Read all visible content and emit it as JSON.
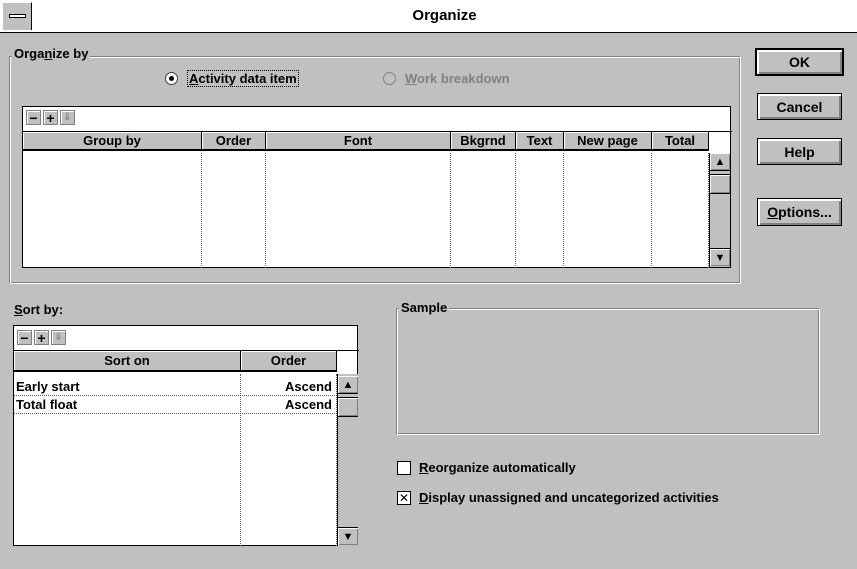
{
  "window": {
    "title": "Organize"
  },
  "organize_by": {
    "label_pre": "Orga",
    "label_key": "n",
    "label_post": "ize by",
    "options": [
      {
        "key": "A",
        "rest": "ctivity data item",
        "selected": true,
        "enabled": true
      },
      {
        "key": "W",
        "rest": "ork breakdown",
        "selected": false,
        "enabled": false
      }
    ],
    "toolbar": {
      "remove": "−",
      "add": "+",
      "move": "⇓"
    },
    "columns": [
      "Group by",
      "Order",
      "Font",
      "Bkgrnd",
      "Text",
      "New page",
      "Total"
    ],
    "rows": []
  },
  "sort_by": {
    "label_key": "S",
    "label_rest": "ort by:",
    "toolbar": {
      "remove": "−",
      "add": "+",
      "move": "⇓"
    },
    "columns": [
      "Sort on",
      "Order"
    ],
    "rows": [
      {
        "sort_on": "Early start",
        "order": "Ascend"
      },
      {
        "sort_on": "Total float",
        "order": "Ascend"
      }
    ]
  },
  "sample": {
    "label": "Sample"
  },
  "checkboxes": [
    {
      "key": "R",
      "rest": "eorganize automatically",
      "checked": false
    },
    {
      "key": "D",
      "rest": "isplay unassigned and uncategorized activities",
      "checked": true
    }
  ],
  "buttons": {
    "ok": "OK",
    "cancel": "Cancel",
    "help": "Help",
    "options_key": "O",
    "options_rest": "ptions..."
  },
  "scroll": {
    "up": "▲",
    "down": "▼"
  }
}
